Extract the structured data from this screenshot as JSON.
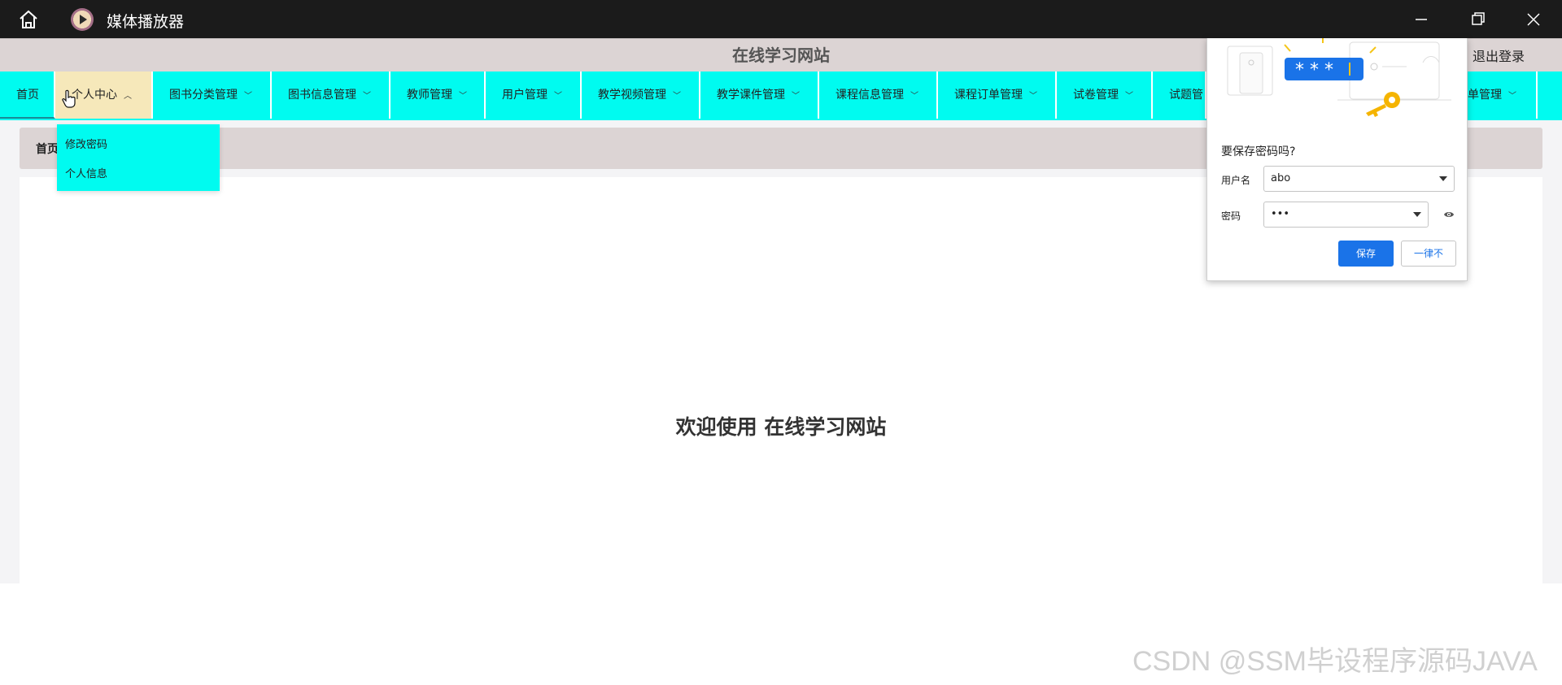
{
  "window": {
    "title": "媒体播放器",
    "icons": [
      "home-icon",
      "media-player-logo",
      "minimize-icon",
      "restore-icon",
      "close-icon"
    ]
  },
  "header": {
    "site_title": "在线学习网站",
    "logout_label": "退出登录"
  },
  "nav": {
    "items": [
      {
        "label": "首页"
      },
      {
        "label": "个人中心"
      },
      {
        "label": "图书分类管理"
      },
      {
        "label": "图书信息管理"
      },
      {
        "label": "教师管理"
      },
      {
        "label": "用户管理"
      },
      {
        "label": "教学视频管理"
      },
      {
        "label": "教学课件管理"
      },
      {
        "label": "课程信息管理"
      },
      {
        "label": "课程订单管理"
      },
      {
        "label": "试卷管理"
      },
      {
        "label": "试题管"
      },
      {
        "label": "单管理"
      }
    ],
    "dropdown": [
      "修改密码",
      "个人信息"
    ],
    "colors": {
      "nav_bg": "#00fbf0",
      "active_bg": "#f6e8ba"
    }
  },
  "breadcrumb": {
    "label": "首页"
  },
  "main": {
    "welcome": "欢迎使用 在线学习网站"
  },
  "password_prompt": {
    "question": "要保存密码吗?",
    "username_label": "用户名",
    "username_value": "abo",
    "password_label": "密码",
    "password_value": "•••",
    "save_label": "保存",
    "never_label": "一律不",
    "accent": "#1a73e8"
  },
  "watermark": "CSDN @SSM毕设程序源码JAVA"
}
